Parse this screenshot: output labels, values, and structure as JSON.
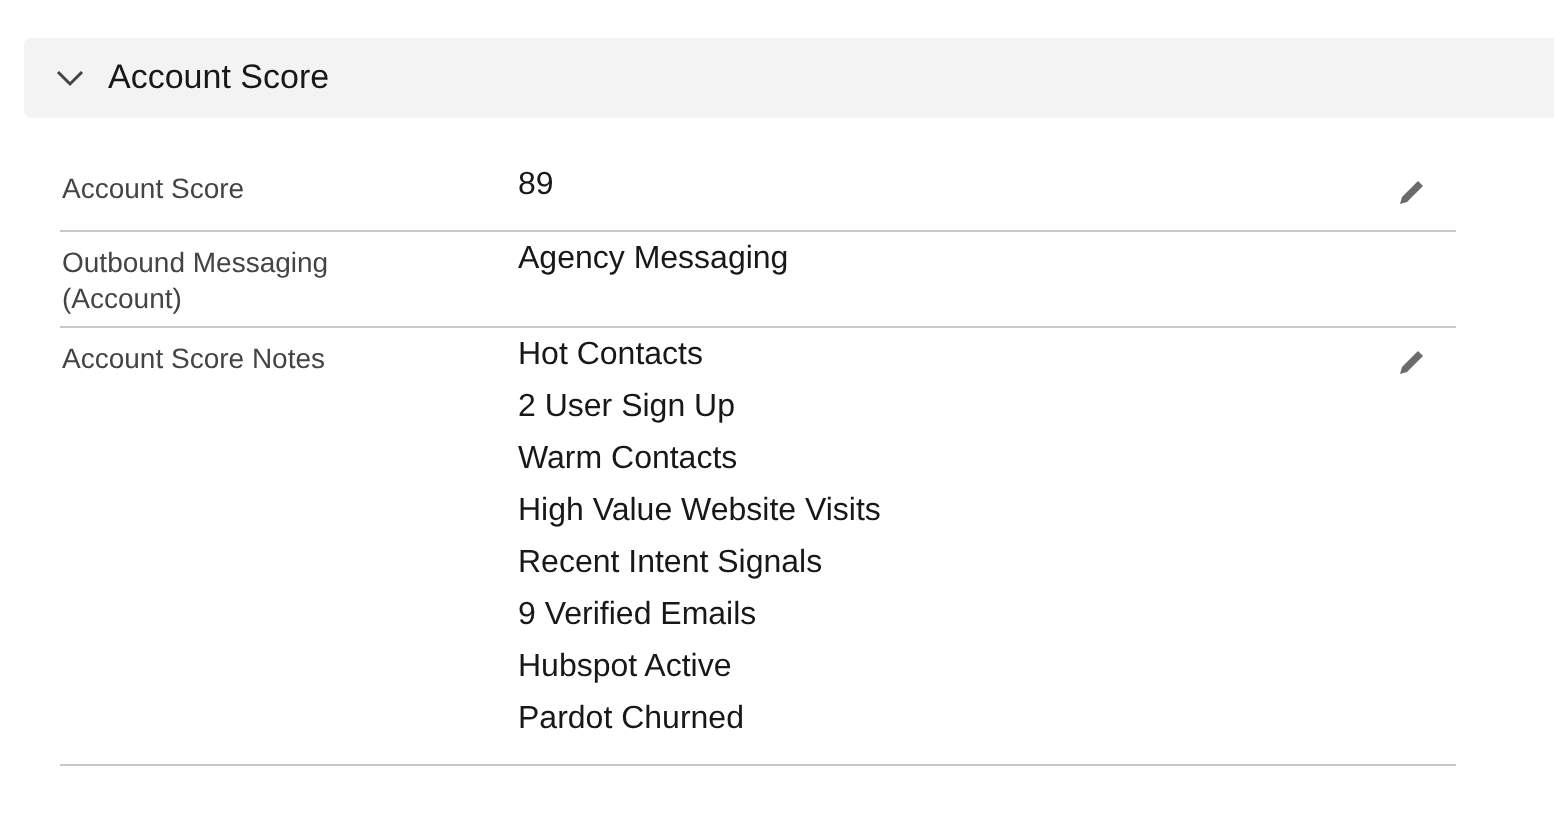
{
  "section": {
    "title": "Account Score",
    "expanded": true,
    "fields": [
      {
        "label": "Account Score",
        "values": [
          "89"
        ],
        "editable": true
      },
      {
        "label": "Outbound Messaging (Account)",
        "values": [
          "Agency Messaging"
        ],
        "editable": false
      },
      {
        "label": "Account Score Notes",
        "values": [
          "Hot Contacts",
          "2 User Sign Up",
          "Warm Contacts",
          "High Value Website Visits",
          "Recent Intent Signals",
          "9 Verified Emails",
          "Hubspot Active",
          "Pardot Churned"
        ],
        "editable": true
      }
    ]
  }
}
